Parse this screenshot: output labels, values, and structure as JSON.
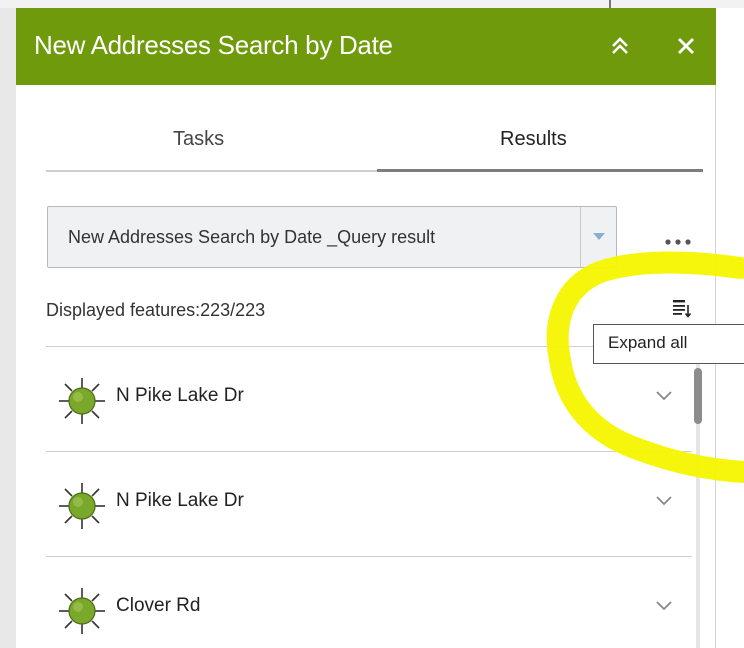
{
  "window": {
    "title": "New Addresses Search by Date"
  },
  "header": {
    "collapse_icon": "double-chevron-up-icon",
    "close_icon": "close-icon"
  },
  "tabs": [
    {
      "label": "Tasks",
      "active": false
    },
    {
      "label": "Results",
      "active": true
    }
  ],
  "results": {
    "layer_select": {
      "value": "New Addresses Search by Date _Query result"
    },
    "more_icon": "ellipsis-icon",
    "displayed_features": "Displayed features:223/223",
    "expand_icon": "expand-all-icon",
    "tooltip": "Expand all",
    "items": [
      {
        "label": "N Pike Lake Dr",
        "icon": "sun-marker-icon"
      },
      {
        "label": "N Pike Lake Dr",
        "icon": "sun-marker-icon"
      },
      {
        "label": "Clover Rd",
        "icon": "sun-marker-icon"
      }
    ]
  },
  "colors": {
    "header_bg": "#6e9a0c",
    "header_text": "#ffffff",
    "marker_fill": "#7aa82a",
    "highlight": "#f5f500"
  }
}
